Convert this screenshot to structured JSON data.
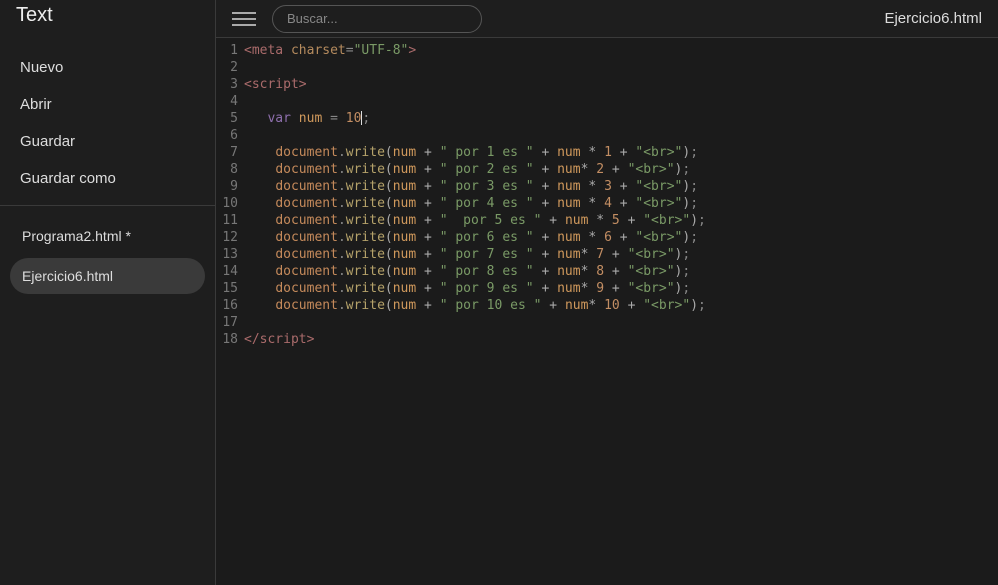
{
  "sidebar": {
    "title": "Text",
    "menu": [
      {
        "label": "Nuevo"
      },
      {
        "label": "Abrir"
      },
      {
        "label": "Guardar"
      },
      {
        "label": "Guardar como"
      }
    ],
    "files": [
      {
        "label": "Programa2.html *",
        "selected": false
      },
      {
        "label": "Ejercicio6.html",
        "selected": true
      }
    ]
  },
  "topbar": {
    "search_placeholder": "Buscar...",
    "open_file": "Ejercicio6.html"
  },
  "editor": {
    "lines": [
      {
        "n": 1,
        "tokens": [
          [
            "t-tag",
            "<meta"
          ],
          [
            "",
            ""
          ],
          [
            "t-op",
            " "
          ],
          [
            "t-attr",
            "charset"
          ],
          [
            "t-punc",
            "="
          ],
          [
            "t-str",
            "\"UTF-8\""
          ],
          [
            "t-tag",
            ">"
          ]
        ]
      },
      {
        "n": 2,
        "tokens": []
      },
      {
        "n": 3,
        "tokens": [
          [
            "t-tag",
            "<script>"
          ]
        ]
      },
      {
        "n": 4,
        "tokens": []
      },
      {
        "n": 5,
        "tokens": [
          [
            "",
            "   "
          ],
          [
            "t-kw",
            "var"
          ],
          [
            "",
            " "
          ],
          [
            "t-var",
            "num"
          ],
          [
            "",
            " "
          ],
          [
            "t-punc",
            "="
          ],
          [
            "",
            " "
          ],
          [
            "t-num",
            "10"
          ],
          [
            "cursor",
            ""
          ],
          [
            "t-punc",
            ";"
          ]
        ]
      },
      {
        "n": 6,
        "tokens": []
      },
      {
        "n": 7,
        "tokens": [
          [
            "",
            "    "
          ],
          [
            "t-obj",
            "document"
          ],
          [
            "t-punc",
            "."
          ],
          [
            "t-func",
            "write"
          ],
          [
            "t-paren",
            "("
          ],
          [
            "t-var",
            "num"
          ],
          [
            "",
            " "
          ],
          [
            "t-op",
            "+"
          ],
          [
            "",
            " "
          ],
          [
            "t-str",
            "\" por 1 es \""
          ],
          [
            "",
            " "
          ],
          [
            "t-op",
            "+"
          ],
          [
            "",
            " "
          ],
          [
            "t-var",
            "num"
          ],
          [
            "",
            " "
          ],
          [
            "t-op",
            "*"
          ],
          [
            "",
            " "
          ],
          [
            "t-num",
            "1"
          ],
          [
            "",
            " "
          ],
          [
            "t-op",
            "+"
          ],
          [
            "",
            " "
          ],
          [
            "t-str",
            "\"<br>\""
          ],
          [
            "t-paren",
            ")"
          ],
          [
            "t-punc",
            ";"
          ]
        ]
      },
      {
        "n": 8,
        "tokens": [
          [
            "",
            "    "
          ],
          [
            "t-obj",
            "document"
          ],
          [
            "t-punc",
            "."
          ],
          [
            "t-func",
            "write"
          ],
          [
            "t-paren",
            "("
          ],
          [
            "t-var",
            "num"
          ],
          [
            "",
            " "
          ],
          [
            "t-op",
            "+"
          ],
          [
            "",
            " "
          ],
          [
            "t-str",
            "\" por 2 es \""
          ],
          [
            "",
            " "
          ],
          [
            "t-op",
            "+"
          ],
          [
            "",
            " "
          ],
          [
            "t-var",
            "num"
          ],
          [
            "t-op",
            "*"
          ],
          [
            "",
            " "
          ],
          [
            "t-num",
            "2"
          ],
          [
            "",
            " "
          ],
          [
            "t-op",
            "+"
          ],
          [
            "",
            " "
          ],
          [
            "t-str",
            "\"<br>\""
          ],
          [
            "t-paren",
            ")"
          ],
          [
            "t-punc",
            ";"
          ]
        ]
      },
      {
        "n": 9,
        "tokens": [
          [
            "",
            "    "
          ],
          [
            "t-obj",
            "document"
          ],
          [
            "t-punc",
            "."
          ],
          [
            "t-func",
            "write"
          ],
          [
            "t-paren",
            "("
          ],
          [
            "t-var",
            "num"
          ],
          [
            "",
            " "
          ],
          [
            "t-op",
            "+"
          ],
          [
            "",
            " "
          ],
          [
            "t-str",
            "\" por 3 es \""
          ],
          [
            "",
            " "
          ],
          [
            "t-op",
            "+"
          ],
          [
            "",
            " "
          ],
          [
            "t-var",
            "num"
          ],
          [
            "",
            " "
          ],
          [
            "t-op",
            "*"
          ],
          [
            "",
            " "
          ],
          [
            "t-num",
            "3"
          ],
          [
            "",
            " "
          ],
          [
            "t-op",
            "+"
          ],
          [
            "",
            " "
          ],
          [
            "t-str",
            "\"<br>\""
          ],
          [
            "t-paren",
            ")"
          ],
          [
            "t-punc",
            ";"
          ]
        ]
      },
      {
        "n": 10,
        "tokens": [
          [
            "",
            "    "
          ],
          [
            "t-obj",
            "document"
          ],
          [
            "t-punc",
            "."
          ],
          [
            "t-func",
            "write"
          ],
          [
            "t-paren",
            "("
          ],
          [
            "t-var",
            "num"
          ],
          [
            "",
            " "
          ],
          [
            "t-op",
            "+"
          ],
          [
            "",
            " "
          ],
          [
            "t-str",
            "\" por 4 es \""
          ],
          [
            "",
            " "
          ],
          [
            "t-op",
            "+"
          ],
          [
            "",
            " "
          ],
          [
            "t-var",
            "num"
          ],
          [
            "",
            " "
          ],
          [
            "t-op",
            "*"
          ],
          [
            "",
            " "
          ],
          [
            "t-num",
            "4"
          ],
          [
            "",
            " "
          ],
          [
            "t-op",
            "+"
          ],
          [
            "",
            " "
          ],
          [
            "t-str",
            "\"<br>\""
          ],
          [
            "t-paren",
            ")"
          ],
          [
            "t-punc",
            ";"
          ]
        ]
      },
      {
        "n": 11,
        "tokens": [
          [
            "",
            "    "
          ],
          [
            "t-obj",
            "document"
          ],
          [
            "t-punc",
            "."
          ],
          [
            "t-func",
            "write"
          ],
          [
            "t-paren",
            "("
          ],
          [
            "t-var",
            "num"
          ],
          [
            "",
            " "
          ],
          [
            "t-op",
            "+"
          ],
          [
            "",
            " "
          ],
          [
            "t-str",
            "\"  por 5 es \""
          ],
          [
            "",
            " "
          ],
          [
            "t-op",
            "+"
          ],
          [
            "",
            " "
          ],
          [
            "t-var",
            "num"
          ],
          [
            "",
            " "
          ],
          [
            "t-op",
            "*"
          ],
          [
            "",
            " "
          ],
          [
            "t-num",
            "5"
          ],
          [
            "",
            " "
          ],
          [
            "t-op",
            "+"
          ],
          [
            "",
            " "
          ],
          [
            "t-str",
            "\"<br>\""
          ],
          [
            "t-paren",
            ")"
          ],
          [
            "t-punc",
            ";"
          ]
        ]
      },
      {
        "n": 12,
        "tokens": [
          [
            "",
            "    "
          ],
          [
            "t-obj",
            "document"
          ],
          [
            "t-punc",
            "."
          ],
          [
            "t-func",
            "write"
          ],
          [
            "t-paren",
            "("
          ],
          [
            "t-var",
            "num"
          ],
          [
            "",
            " "
          ],
          [
            "t-op",
            "+"
          ],
          [
            "",
            " "
          ],
          [
            "t-str",
            "\" por 6 es \""
          ],
          [
            "",
            " "
          ],
          [
            "t-op",
            "+"
          ],
          [
            "",
            " "
          ],
          [
            "t-var",
            "num"
          ],
          [
            "",
            " "
          ],
          [
            "t-op",
            "*"
          ],
          [
            "",
            " "
          ],
          [
            "t-num",
            "6"
          ],
          [
            "",
            " "
          ],
          [
            "t-op",
            "+"
          ],
          [
            "",
            " "
          ],
          [
            "t-str",
            "\"<br>\""
          ],
          [
            "t-paren",
            ")"
          ],
          [
            "t-punc",
            ";"
          ]
        ]
      },
      {
        "n": 13,
        "tokens": [
          [
            "",
            "    "
          ],
          [
            "t-obj",
            "document"
          ],
          [
            "t-punc",
            "."
          ],
          [
            "t-func",
            "write"
          ],
          [
            "t-paren",
            "("
          ],
          [
            "t-var",
            "num"
          ],
          [
            "",
            " "
          ],
          [
            "t-op",
            "+"
          ],
          [
            "",
            " "
          ],
          [
            "t-str",
            "\" por 7 es \""
          ],
          [
            "",
            " "
          ],
          [
            "t-op",
            "+"
          ],
          [
            "",
            " "
          ],
          [
            "t-var",
            "num"
          ],
          [
            "t-op",
            "*"
          ],
          [
            "",
            " "
          ],
          [
            "t-num",
            "7"
          ],
          [
            "",
            " "
          ],
          [
            "t-op",
            "+"
          ],
          [
            "",
            " "
          ],
          [
            "t-str",
            "\"<br>\""
          ],
          [
            "t-paren",
            ")"
          ],
          [
            "t-punc",
            ";"
          ]
        ]
      },
      {
        "n": 14,
        "tokens": [
          [
            "",
            "    "
          ],
          [
            "t-obj",
            "document"
          ],
          [
            "t-punc",
            "."
          ],
          [
            "t-func",
            "write"
          ],
          [
            "t-paren",
            "("
          ],
          [
            "t-var",
            "num"
          ],
          [
            "",
            " "
          ],
          [
            "t-op",
            "+"
          ],
          [
            "",
            " "
          ],
          [
            "t-str",
            "\" por 8 es \""
          ],
          [
            "",
            " "
          ],
          [
            "t-op",
            "+"
          ],
          [
            "",
            " "
          ],
          [
            "t-var",
            "num"
          ],
          [
            "t-op",
            "*"
          ],
          [
            "",
            " "
          ],
          [
            "t-num",
            "8"
          ],
          [
            "",
            " "
          ],
          [
            "t-op",
            "+"
          ],
          [
            "",
            " "
          ],
          [
            "t-str",
            "\"<br>\""
          ],
          [
            "t-paren",
            ")"
          ],
          [
            "t-punc",
            ";"
          ]
        ]
      },
      {
        "n": 15,
        "tokens": [
          [
            "",
            "    "
          ],
          [
            "t-obj",
            "document"
          ],
          [
            "t-punc",
            "."
          ],
          [
            "t-func",
            "write"
          ],
          [
            "t-paren",
            "("
          ],
          [
            "t-var",
            "num"
          ],
          [
            "",
            " "
          ],
          [
            "t-op",
            "+"
          ],
          [
            "",
            " "
          ],
          [
            "t-str",
            "\" por 9 es \""
          ],
          [
            "",
            " "
          ],
          [
            "t-op",
            "+"
          ],
          [
            "",
            " "
          ],
          [
            "t-var",
            "num"
          ],
          [
            "t-op",
            "*"
          ],
          [
            "",
            " "
          ],
          [
            "t-num",
            "9"
          ],
          [
            "",
            " "
          ],
          [
            "t-op",
            "+"
          ],
          [
            "",
            " "
          ],
          [
            "t-str",
            "\"<br>\""
          ],
          [
            "t-paren",
            ")"
          ],
          [
            "t-punc",
            ";"
          ]
        ]
      },
      {
        "n": 16,
        "tokens": [
          [
            "",
            "    "
          ],
          [
            "t-obj",
            "document"
          ],
          [
            "t-punc",
            "."
          ],
          [
            "t-func",
            "write"
          ],
          [
            "t-paren",
            "("
          ],
          [
            "t-var",
            "num"
          ],
          [
            "",
            " "
          ],
          [
            "t-op",
            "+"
          ],
          [
            "",
            " "
          ],
          [
            "t-str",
            "\" por 10 es \""
          ],
          [
            "",
            " "
          ],
          [
            "t-op",
            "+"
          ],
          [
            "",
            " "
          ],
          [
            "t-var",
            "num"
          ],
          [
            "t-op",
            "*"
          ],
          [
            "",
            " "
          ],
          [
            "t-num",
            "10"
          ],
          [
            "",
            " "
          ],
          [
            "t-op",
            "+"
          ],
          [
            "",
            " "
          ],
          [
            "t-str",
            "\"<br>\""
          ],
          [
            "t-paren",
            ")"
          ],
          [
            "t-punc",
            ";"
          ]
        ]
      },
      {
        "n": 17,
        "tokens": []
      },
      {
        "n": 18,
        "tokens": [
          [
            "t-tag",
            "</scr"
          ],
          [
            "t-tag",
            "ipt>"
          ]
        ]
      }
    ]
  }
}
